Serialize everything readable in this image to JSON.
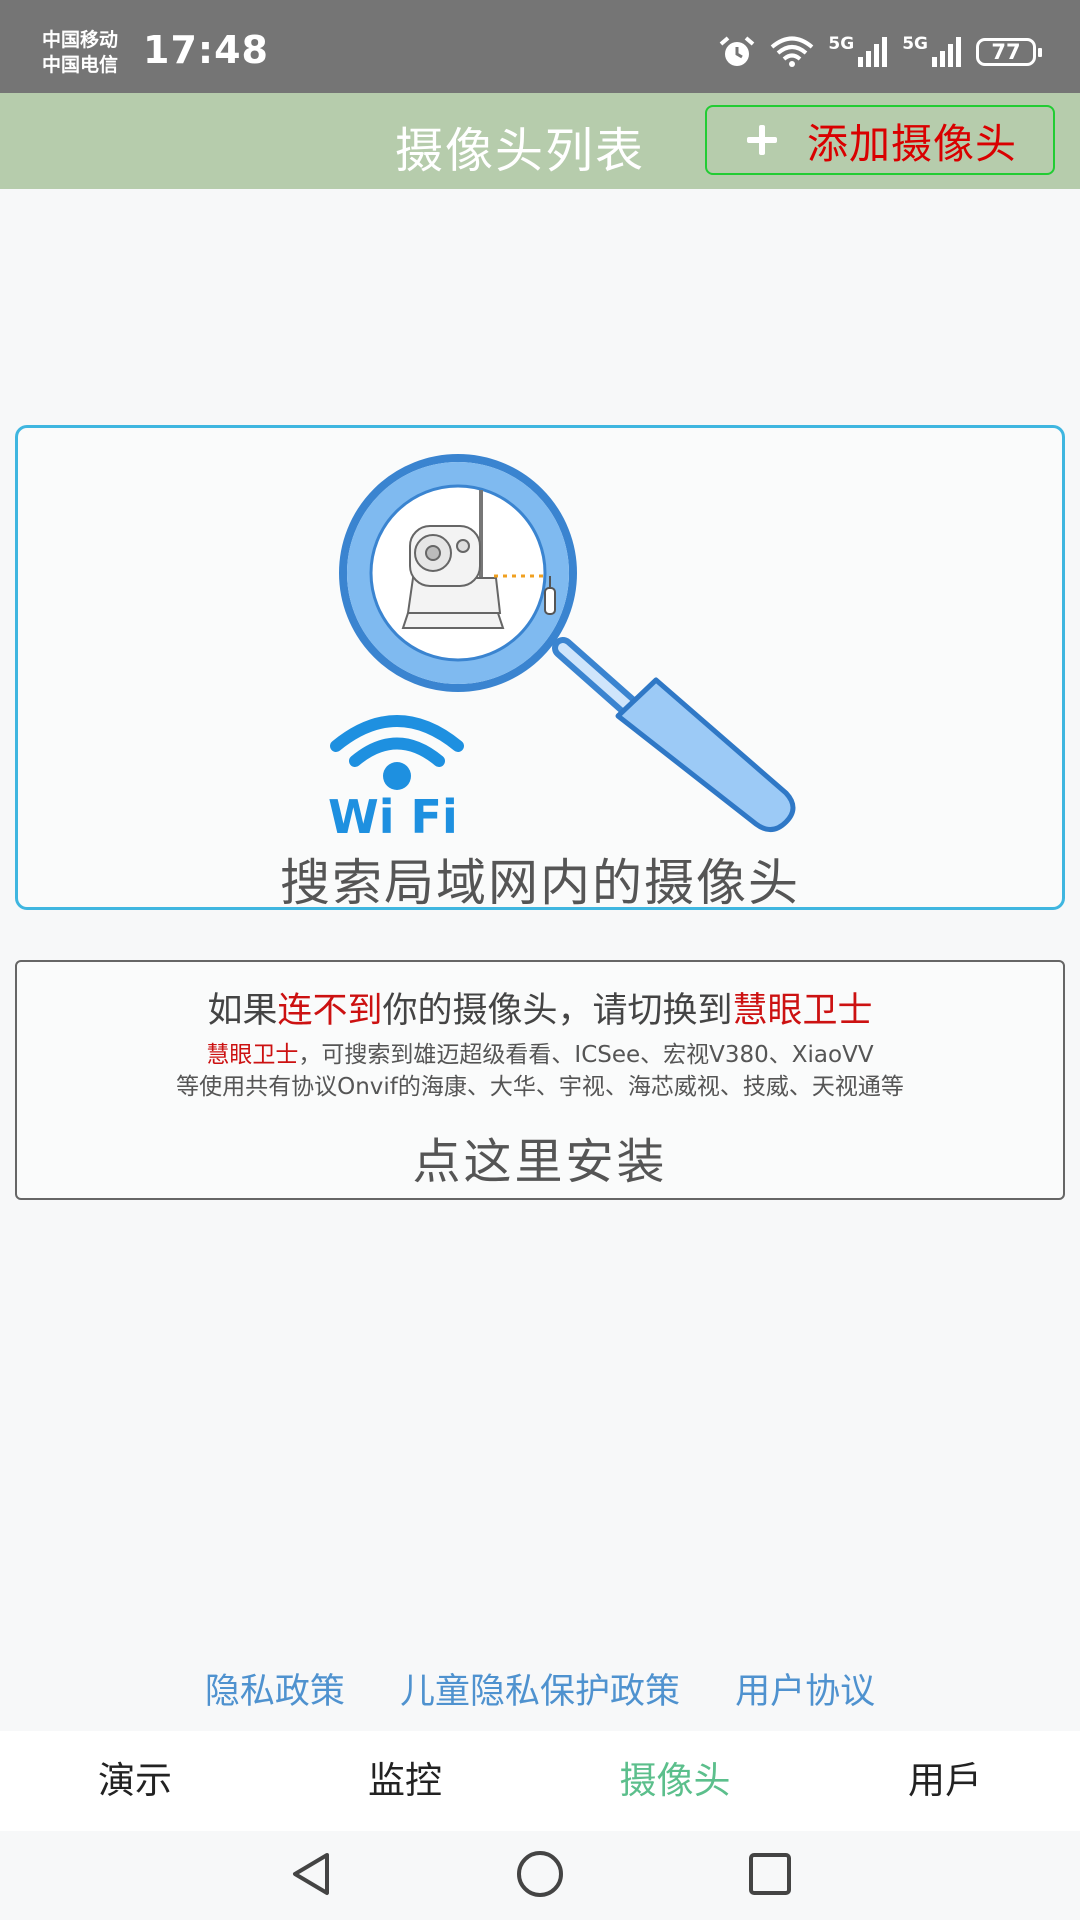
{
  "status_bar": {
    "carrier_1": "中国移动",
    "carrier_2": "中国电信",
    "time": "17:48",
    "net_1": "5G",
    "net_2": "5G",
    "battery": "77",
    "icons": [
      "alarm-icon",
      "wifi-icon",
      "signal-icon",
      "signal-icon",
      "battery-icon"
    ]
  },
  "header": {
    "title": "摄像头列表",
    "add_button_label": "添加摄像头"
  },
  "search_card": {
    "wifi_text": "Wi Fi",
    "label": "搜索局域网内的摄像头"
  },
  "install_card": {
    "line1_part1": "如果",
    "line1_highlight1": "连不到",
    "line1_part2": "你的摄像头，请切换到",
    "line1_highlight2": "慧眼卫士",
    "desc_highlight": "慧眼卫士",
    "desc_line1": "，可搜索到雄迈超级看看、ICSee、宏视V380、XiaoVV",
    "desc_line2": "等使用共有协议Onvif的海康、大华、宇视、海芯威视、技威、天视通等",
    "action": "点这里安装"
  },
  "policy_links": {
    "privacy": "隐私政策",
    "child_privacy": "儿童隐私保护政策",
    "user_agreement": "用户协议"
  },
  "tabs": [
    {
      "label": "演示",
      "active": false
    },
    {
      "label": "监控",
      "active": false
    },
    {
      "label": "摄像头",
      "active": true
    },
    {
      "label": "用戶",
      "active": false
    }
  ],
  "colors": {
    "header_bg": "#b6ccac",
    "accent_red": "#cc1111",
    "active_tab": "#5cbf8c",
    "link_blue": "#4f92cf",
    "card_border": "#3fb6e0"
  }
}
